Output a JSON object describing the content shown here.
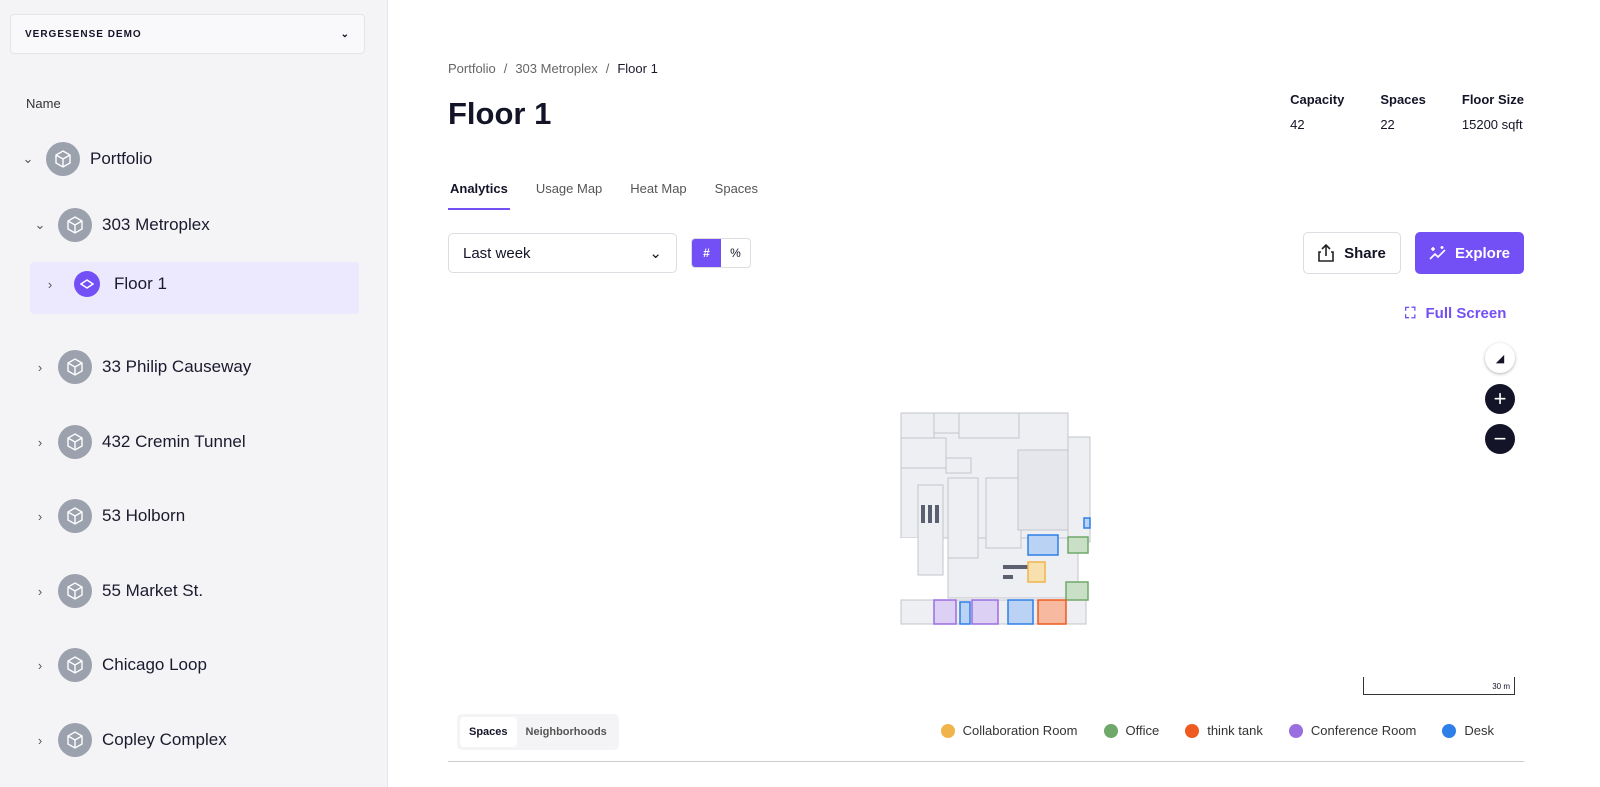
{
  "org": {
    "name": "VERGESENSE DEMO"
  },
  "sidebar": {
    "header": "Name",
    "items": [
      {
        "label": "Portfolio",
        "expanded": true
      },
      {
        "label": "303 Metroplex",
        "expanded": true
      },
      {
        "label": "Floor 1",
        "selected": true
      },
      {
        "label": "33 Philip Causeway"
      },
      {
        "label": "432 Cremin Tunnel"
      },
      {
        "label": "53 Holborn"
      },
      {
        "label": "55 Market St."
      },
      {
        "label": "Chicago Loop"
      },
      {
        "label": "Copley Complex"
      }
    ]
  },
  "breadcrumb": [
    "Portfolio",
    "303 Metroplex",
    "Floor 1"
  ],
  "page": {
    "title": "Floor 1"
  },
  "stats": [
    {
      "label": "Capacity",
      "value": "42"
    },
    {
      "label": "Spaces",
      "value": "22"
    },
    {
      "label": "Floor Size",
      "value": "15200 sqft"
    }
  ],
  "tabs": [
    "Analytics",
    "Usage Map",
    "Heat Map",
    "Spaces"
  ],
  "controls": {
    "range": "Last week",
    "num": "#",
    "pct": "%",
    "share": "Share",
    "explore": "Explore",
    "fullscreen": "Full Screen",
    "scale": "30 m"
  },
  "bottom_tabs": [
    "Spaces",
    "Neighborhoods"
  ],
  "legend": [
    {
      "label": "Collaboration Room",
      "color": "#f0b44a"
    },
    {
      "label": "Office",
      "color": "#6fa86a"
    },
    {
      "label": "think tank",
      "color": "#ee5a1f"
    },
    {
      "label": "Conference Room",
      "color": "#9a6ee0"
    },
    {
      "label": "Desk",
      "color": "#2f7fe8"
    }
  ],
  "accent": "#7350f5"
}
